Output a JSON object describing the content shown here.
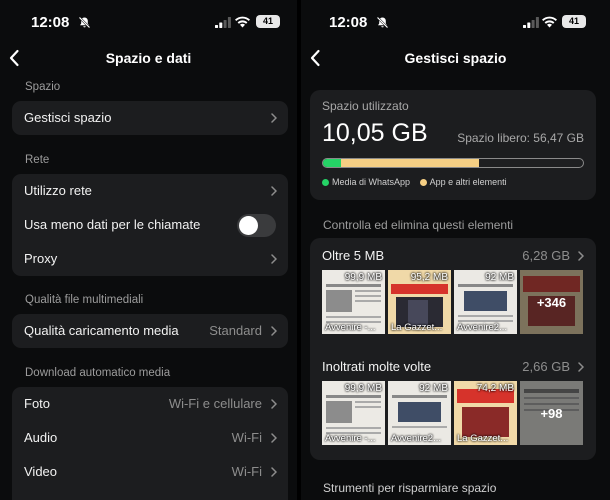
{
  "status": {
    "time": "12:08",
    "battery": "41"
  },
  "left": {
    "title": "Spazio e dati",
    "sections": {
      "space": "Spazio",
      "network": "Rete",
      "quality": "Qualità file multimediali",
      "autodownload": "Download automatico media"
    },
    "rows": {
      "manage_space": "Gestisci spazio",
      "network_usage": "Utilizzo rete",
      "less_data_calls": "Usa meno dati per le chiamate",
      "proxy": "Proxy",
      "upload_quality": {
        "label": "Qualità caricamento media",
        "value": "Standard"
      },
      "photo": {
        "label": "Foto",
        "value": "Wi-Fi e cellulare"
      },
      "audio": {
        "label": "Audio",
        "value": "Wi-Fi"
      },
      "video": {
        "label": "Video",
        "value": "Wi-Fi"
      }
    },
    "less_data_calls_on": false
  },
  "right": {
    "title": "Gestisci spazio",
    "usage": {
      "label": "Spazio utilizzato",
      "value": "10,05 GB",
      "free": "Spazio libero: 56,47 GB",
      "whatsapp_fraction": 0.07,
      "apps_fraction": 0.53,
      "legend_whatsapp": "Media di WhatsApp",
      "legend_apps": "App e altri elementi",
      "color_whatsapp": "#25d366",
      "color_apps": "#f5cf84"
    },
    "review_title": "Controlla ed elimina questi elementi",
    "groups": [
      {
        "title": "Oltre 5 MB",
        "size": "6,28 GB",
        "thumbs": [
          {
            "size": "99,9 MB",
            "name": "Avvenire -..."
          },
          {
            "size": "95,2 MB",
            "name": "La Gazzet..."
          },
          {
            "size": "92 MB",
            "name": "Avvenire2..."
          },
          {
            "more": "+346"
          }
        ]
      },
      {
        "title": "Inoltrati molte volte",
        "size": "2,66 GB",
        "thumbs": [
          {
            "size": "99,9 MB",
            "name": "Avvenire -..."
          },
          {
            "size": "92 MB",
            "name": "Avvenire2..."
          },
          {
            "size": "74,2 MB",
            "name": "La Gazzet..."
          },
          {
            "more": "+98"
          }
        ]
      }
    ],
    "tools_title": "Strumenti per risparmiare spazio"
  }
}
